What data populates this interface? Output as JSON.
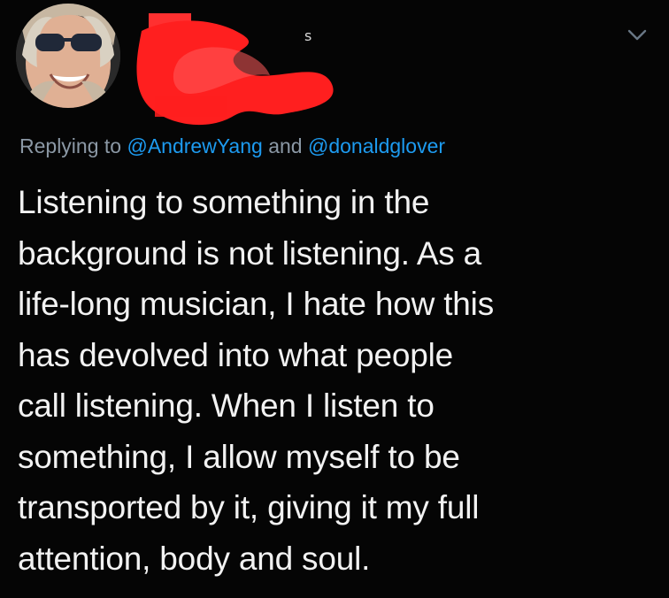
{
  "tweet": {
    "avatar_icon": "profile-photo-avatar",
    "reply_prefix": "Replying to",
    "reply_mention_1": "@AndrewYang",
    "reply_conjunction": "and",
    "reply_mention_2": "@donaldglover",
    "text_lines": [
      "Listening to something in the",
      "background is not listening. As a",
      "life-long musician, I hate how this",
      "has devolved into what people",
      "call listening. When I listen to",
      "something, I allow myself to be",
      "transported by it, giving it my full",
      "attention, body and soul."
    ],
    "menu_icon": "chevron-down-icon"
  },
  "colors": {
    "background": "#050505",
    "text": "#f2f2f2",
    "muted": "#8b98a5",
    "mention": "#1d9bf0",
    "redaction": "#ff1f1f"
  }
}
